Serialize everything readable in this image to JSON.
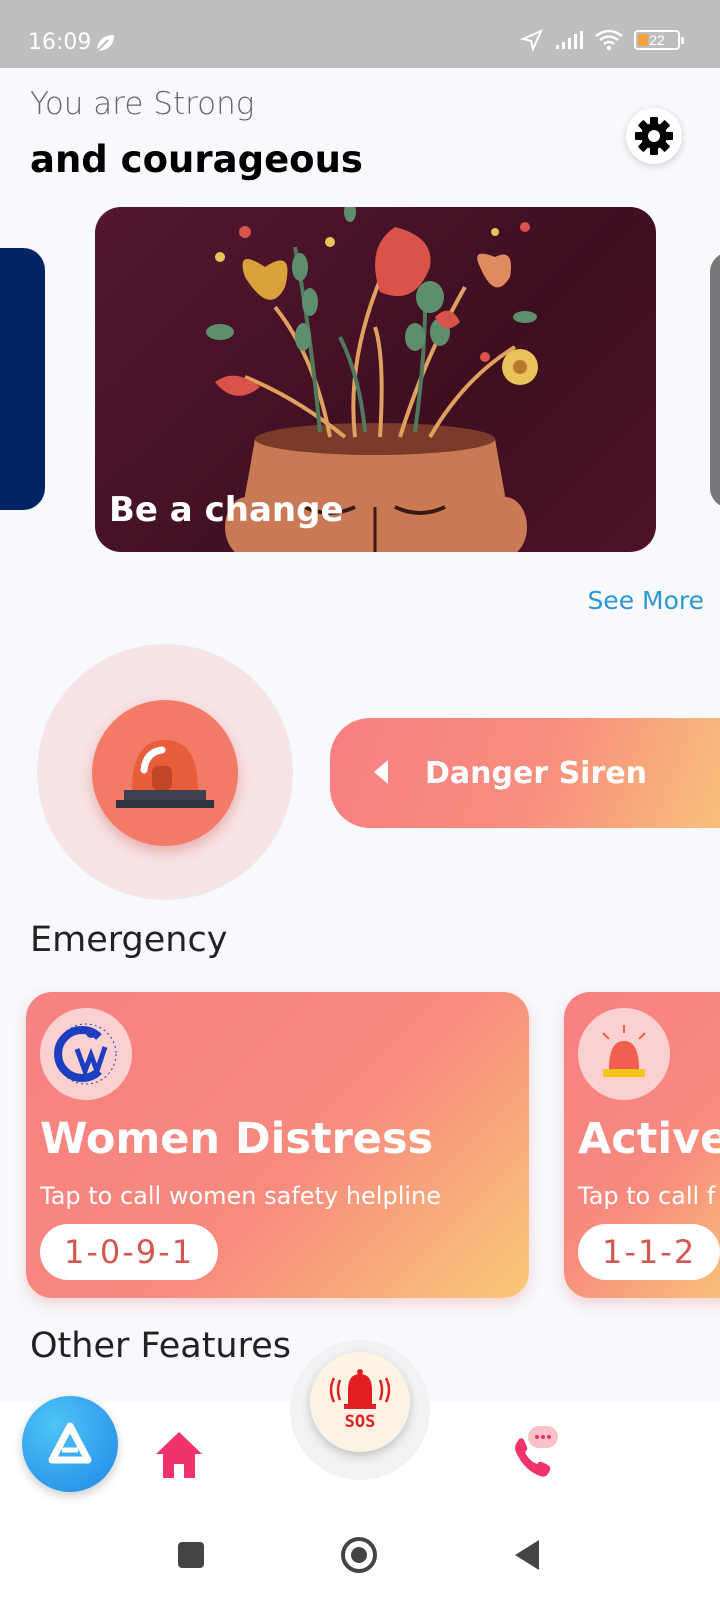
{
  "status_bar": {
    "time": "16:09",
    "battery_level": "22",
    "icons": [
      "leaf-icon",
      "location-icon",
      "signal-icon",
      "wifi-icon",
      "battery-icon"
    ]
  },
  "header": {
    "greeting": "You are Strong",
    "headline": "and courageous",
    "settings_icon": "gear-icon"
  },
  "carousel": {
    "active_title": "Be a change",
    "see_more": "See More"
  },
  "siren": {
    "icon": "siren-icon",
    "label": "Danger Siren"
  },
  "emergency": {
    "title": "Emergency",
    "cards": [
      {
        "title": "Women Distress",
        "subtitle": "Tap to call women safety helpline",
        "number": "1-0-9-1",
        "icon": "women-welfare-logo"
      },
      {
        "title": "Active",
        "subtitle": "Tap to call f",
        "number": "1-1-2",
        "icon": "siren-icon"
      }
    ]
  },
  "other_features": {
    "title": "Other Features"
  },
  "bottom_nav": {
    "sos_label": "SOS",
    "items": [
      "app-logo",
      "home-icon",
      "sos-bell-icon",
      "call-chat-icon"
    ]
  },
  "colors": {
    "accent": "#2a98d4",
    "card_gradient_start": "#f88082",
    "card_gradient_end": "#f9c978",
    "siren": "#f37a66"
  }
}
